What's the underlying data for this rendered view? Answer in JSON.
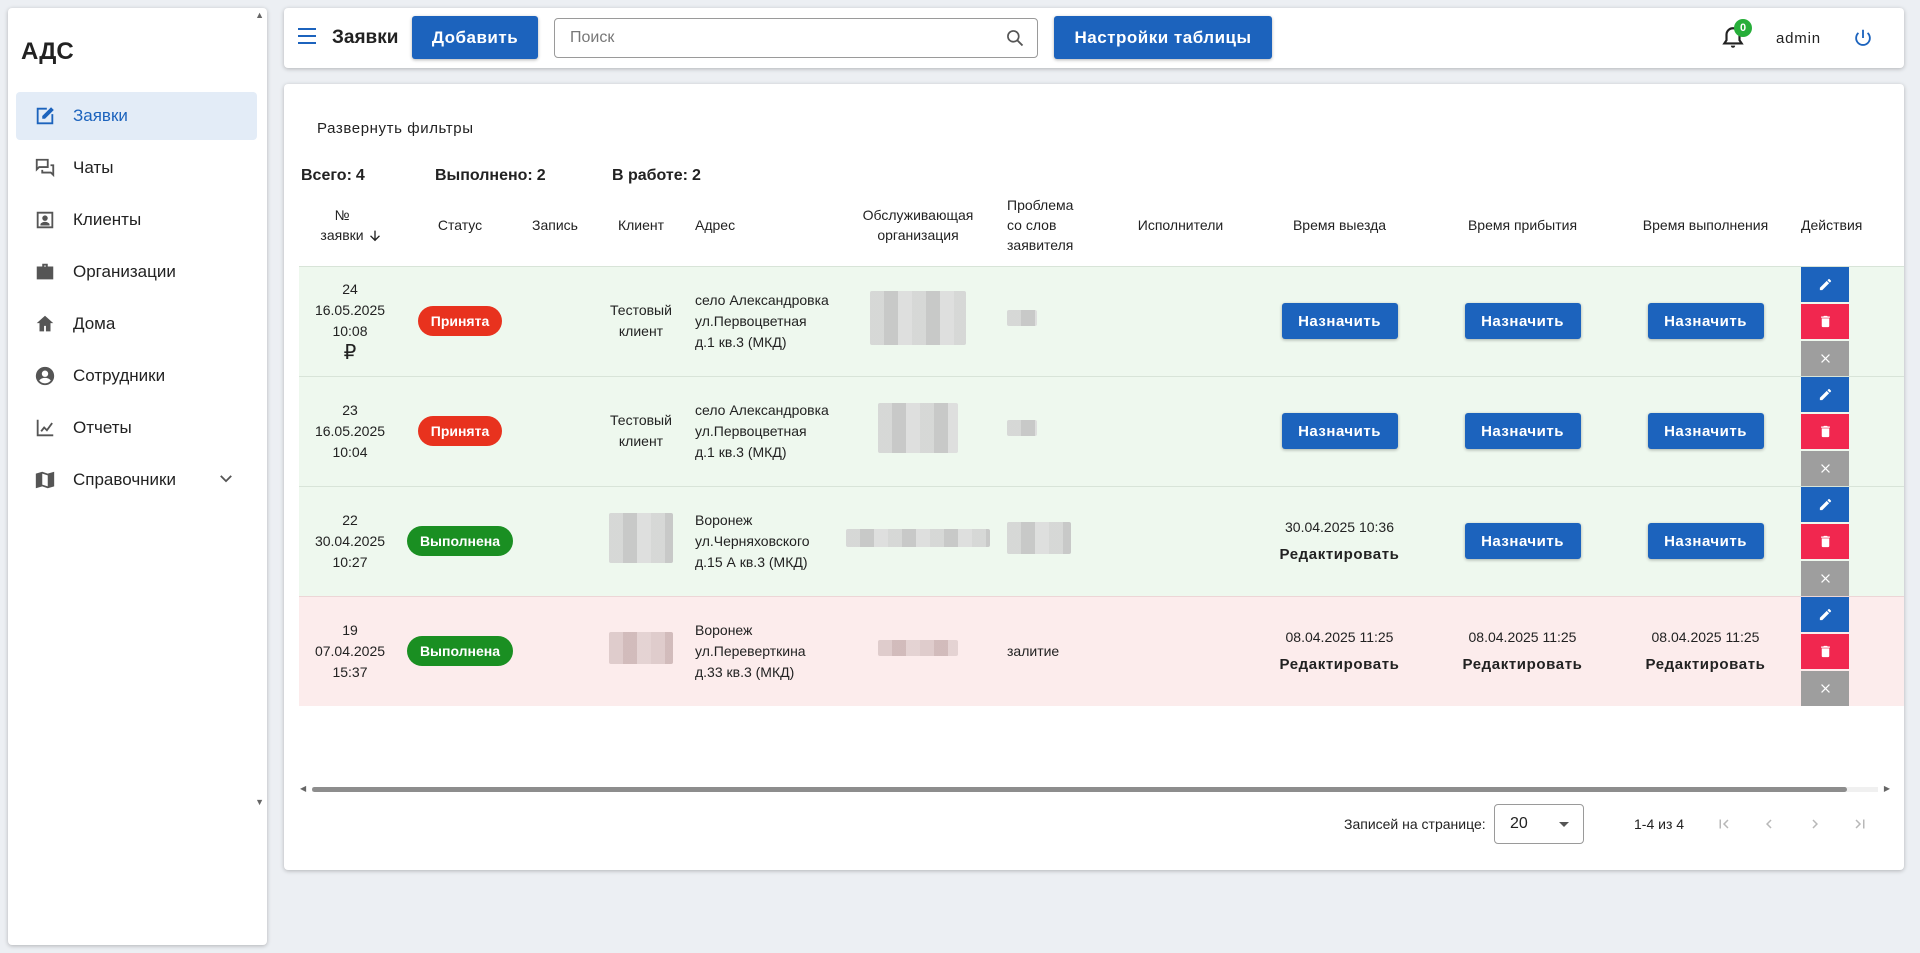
{
  "sidebar": {
    "brand": "АДС",
    "items": [
      {
        "label": "Заявки",
        "icon": "edit-icon",
        "active": true
      },
      {
        "label": "Чаты",
        "icon": "chat-icon"
      },
      {
        "label": "Клиенты",
        "icon": "contact-card-icon"
      },
      {
        "label": "Организации",
        "icon": "briefcase-icon"
      },
      {
        "label": "Дома",
        "icon": "home-icon"
      },
      {
        "label": "Сотрудники",
        "icon": "account-circle-icon"
      },
      {
        "label": "Отчеты",
        "icon": "chart-line-icon"
      },
      {
        "label": "Справочники",
        "icon": "book-icon",
        "expandable": true
      }
    ]
  },
  "header": {
    "title": "Заявки",
    "add_label": "Добавить",
    "search_placeholder": "Поиск",
    "settings_label": "Настройки таблицы",
    "notifications_count": "0",
    "user": "admin"
  },
  "main": {
    "expand_filters": "Развернуть фильтры",
    "summary": {
      "total_label": "Всего:",
      "total": "4",
      "done_label": "Выполнено:",
      "done": "2",
      "inwork_label": "В работе:",
      "inwork": "2"
    },
    "columns": {
      "number": "№ заявки",
      "status": "Статус",
      "record": "Запись",
      "client": "Клиент",
      "address": "Адрес",
      "org": "Обслуживающая организация",
      "problem": "Проблема со слов заявителя",
      "executors": "Исполнители",
      "departure": "Время выезда",
      "arrival": "Время прибытия",
      "completion": "Время выполнения",
      "actions": "Действия"
    },
    "assign_label": "Назначить",
    "edit_label": "Редактировать",
    "rows": [
      {
        "num": "24",
        "date": "16.05.2025",
        "time": "10:08",
        "currency": "₽",
        "status": "Принята",
        "status_type": "accepted",
        "client": "Тестовый клиент",
        "address": "село Александровка ул.Первоцветная д.1 кв.3 (МКД)",
        "problem": "",
        "departure": "",
        "arrival": "",
        "completion": "",
        "color": "green"
      },
      {
        "num": "23",
        "date": "16.05.2025",
        "time": "10:04",
        "currency": "",
        "status": "Принята",
        "status_type": "accepted",
        "client": "Тестовый клиент",
        "address": "село Александровка ул.Первоцветная д.1 кв.3 (МКД)",
        "problem": "",
        "departure": "",
        "arrival": "",
        "completion": "",
        "color": "green"
      },
      {
        "num": "22",
        "date": "30.04.2025",
        "time": "10:27",
        "currency": "",
        "status": "Выполнена",
        "status_type": "done",
        "client": "",
        "address": "Воронеж ул.Черняховского д.15 А кв.3 (МКД)",
        "problem": "",
        "departure": "30.04.2025 10:36",
        "arrival": "",
        "completion": "",
        "color": "green"
      },
      {
        "num": "19",
        "date": "07.04.2025",
        "time": "15:37",
        "currency": "",
        "status": "Выполнена",
        "status_type": "done",
        "client": "",
        "address": "Воронеж ул.Переверткина д.33 кв.3 (МКД)",
        "problem": "залитие",
        "departure": "08.04.2025 11:25",
        "arrival": "08.04.2025 11:25",
        "completion": "08.04.2025 11:25",
        "color": "red"
      }
    ]
  },
  "pager": {
    "label": "Записей на странице:",
    "per_page": "20",
    "range": "1-4 из 4"
  },
  "colors": {
    "primary": "#1c63bd",
    "accepted": "#e8321e",
    "done": "#1a8f22",
    "delete": "#f1274f",
    "cancel": "#9e9e9e",
    "badge": "#27ae3a"
  }
}
